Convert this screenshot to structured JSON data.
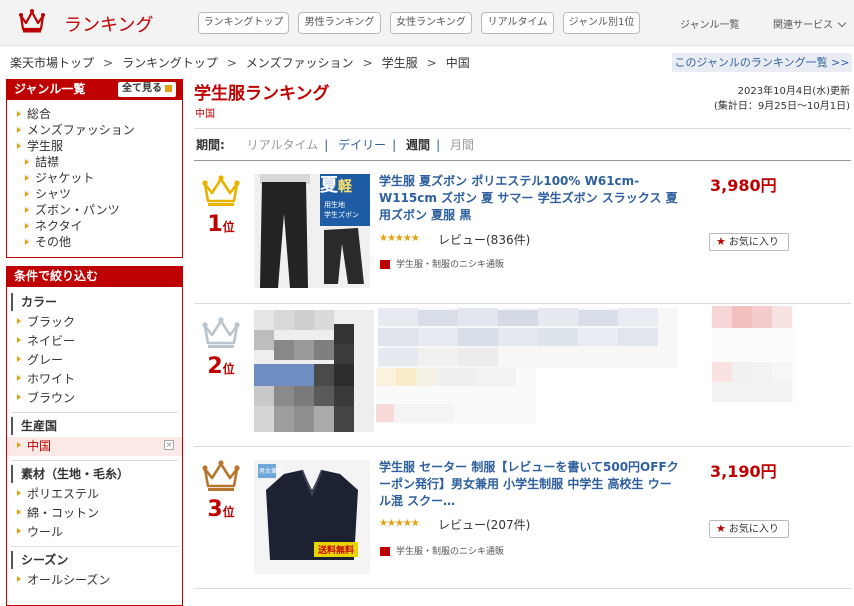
{
  "header": {
    "brand": "ランキング",
    "tabs": [
      "ランキングトップ",
      "男性ランキング",
      "女性ランキング",
      "リアルタイム",
      "ジャンル別1位"
    ],
    "genre_list": "ジャンル一覧",
    "related": "関連サービス"
  },
  "breadcrumb": [
    "楽天市場トップ",
    "ランキングトップ",
    "メンズファッション",
    "学生服",
    "中国"
  ],
  "genre_ranking_link": "このジャンルのランキング一覧 >>",
  "sidebar": {
    "genre_title": "ジャンル一覧",
    "all_button": "全て見る",
    "genres": [
      "総合",
      "メンズファッション",
      "学生服"
    ],
    "subgenres": [
      "詰襟",
      "ジャケット",
      "シャツ",
      "ズボン・パンツ",
      "ネクタイ",
      "その他"
    ],
    "filter_title": "条件で絞り込む",
    "color_title": "カラー",
    "colors": [
      "ブラック",
      "ネイビー",
      "グレー",
      "ホワイト",
      "ブラウン"
    ],
    "origin_title": "生産国",
    "origin_selected": "中国",
    "material_title": "素材（生地・毛糸）",
    "materials": [
      "ポリエステル",
      "綿・コットン",
      "ウール"
    ],
    "season_title": "シーズン",
    "seasons": [
      "オールシーズン"
    ]
  },
  "main": {
    "title": "学生服ランキング",
    "subtitle": "中国",
    "updated": "2023年10月4日(水)更新",
    "period_range": "(集計日：9月25日〜10月1日)",
    "period_label": "期間:",
    "periods": [
      "リアルタイム",
      "デイリー",
      "週間",
      "月間"
    ],
    "items": [
      {
        "rank": "1",
        "rank_suffix": "位",
        "name": "学生服 夏ズボン ポリエステル100% W61cm-W115cm ズボン 夏 サマー 学生ズボン スラックス 夏用ズボン 夏服 黒",
        "price": "3,980円",
        "stars": "★★★★★",
        "review": "レビュー(836件)",
        "shop": "学生服・制服のニシキ通販",
        "fav": "お気に入り",
        "img_text": [
          "夏",
          "軽",
          "用生地",
          "学生ズボン"
        ]
      },
      {
        "rank": "2",
        "rank_suffix": "位"
      },
      {
        "rank": "3",
        "rank_suffix": "位",
        "name": "学生服 セーター 制服【レビューを書いて500円OFFクーポン発行】男女兼用 小学生制服 中学生 高校生 ウール混 スクー…",
        "price": "3,190円",
        "stars": "★★★★★",
        "review": "レビュー(207件)",
        "shop": "学生服・制服のニシキ通販",
        "fav": "お気に入り",
        "img_text": [
          "送料無料",
          "男女兼用"
        ]
      }
    ]
  },
  "colors": {
    "accent": "#bf0000",
    "link": "#2e5f9f",
    "star": "#e5a00d",
    "gold": "#e8b400",
    "silver": "#b9c4cf",
    "bronze": "#b5772e"
  }
}
